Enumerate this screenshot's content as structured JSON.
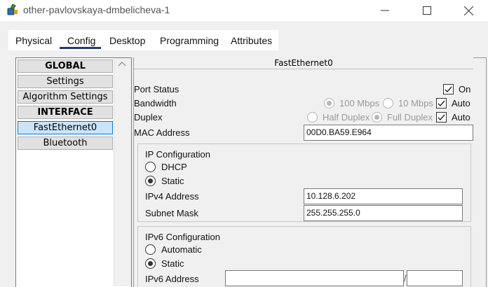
{
  "window": {
    "title": "other-pavlovskaya-dmbelicheva-1",
    "minimize": "—",
    "maximize": "☐",
    "close": "✕",
    "app_icon": "packet-tracer-device-icon"
  },
  "tabs": [
    {
      "label": "Physical"
    },
    {
      "label": "Config",
      "selected": true
    },
    {
      "label": "Desktop"
    },
    {
      "label": "Programming"
    },
    {
      "label": "Attributes"
    }
  ],
  "sidebar": {
    "items": [
      {
        "label": "GLOBAL",
        "type": "header"
      },
      {
        "label": "Settings"
      },
      {
        "label": "Algorithm Settings"
      },
      {
        "label": "INTERFACE",
        "type": "header"
      },
      {
        "label": "FastEthernet0",
        "selected": true
      },
      {
        "label": "Bluetooth"
      }
    ]
  },
  "panel": {
    "title": "FastEthernet0",
    "port_status": {
      "label": "Port Status",
      "on_label": "On",
      "checked": true
    },
    "bandwidth": {
      "label": "Bandwidth",
      "opt1": "100 Mbps",
      "opt2": "10 Mbps",
      "auto_label": "Auto",
      "auto_checked": true,
      "selected": "100 Mbps"
    },
    "duplex": {
      "label": "Duplex",
      "opt1": "Half Duplex",
      "opt2": "Full Duplex",
      "auto_label": "Auto",
      "auto_checked": true,
      "selected": "Full Duplex"
    },
    "mac": {
      "label": "MAC Address",
      "value": "00D0.BA59.E964"
    },
    "ipv4": {
      "title": "IP Configuration",
      "dhcp_label": "DHCP",
      "static_label": "Static",
      "selected": "Static",
      "address_label": "IPv4 Address",
      "address_value": "10.128.6.202",
      "mask_label": "Subnet Mask",
      "mask_value": "255.255.255.0"
    },
    "ipv6": {
      "title": "IPv6 Configuration",
      "auto_label": "Automatic",
      "static_label": "Static",
      "selected": "Static",
      "address_label": "IPv6 Address",
      "address_value": "",
      "prefix_sep": "/",
      "prefix_value": ""
    }
  },
  "colors": {
    "accent": "#1e3f66",
    "selected_bg": "#cce4f7",
    "selected_border": "#0078d7"
  }
}
